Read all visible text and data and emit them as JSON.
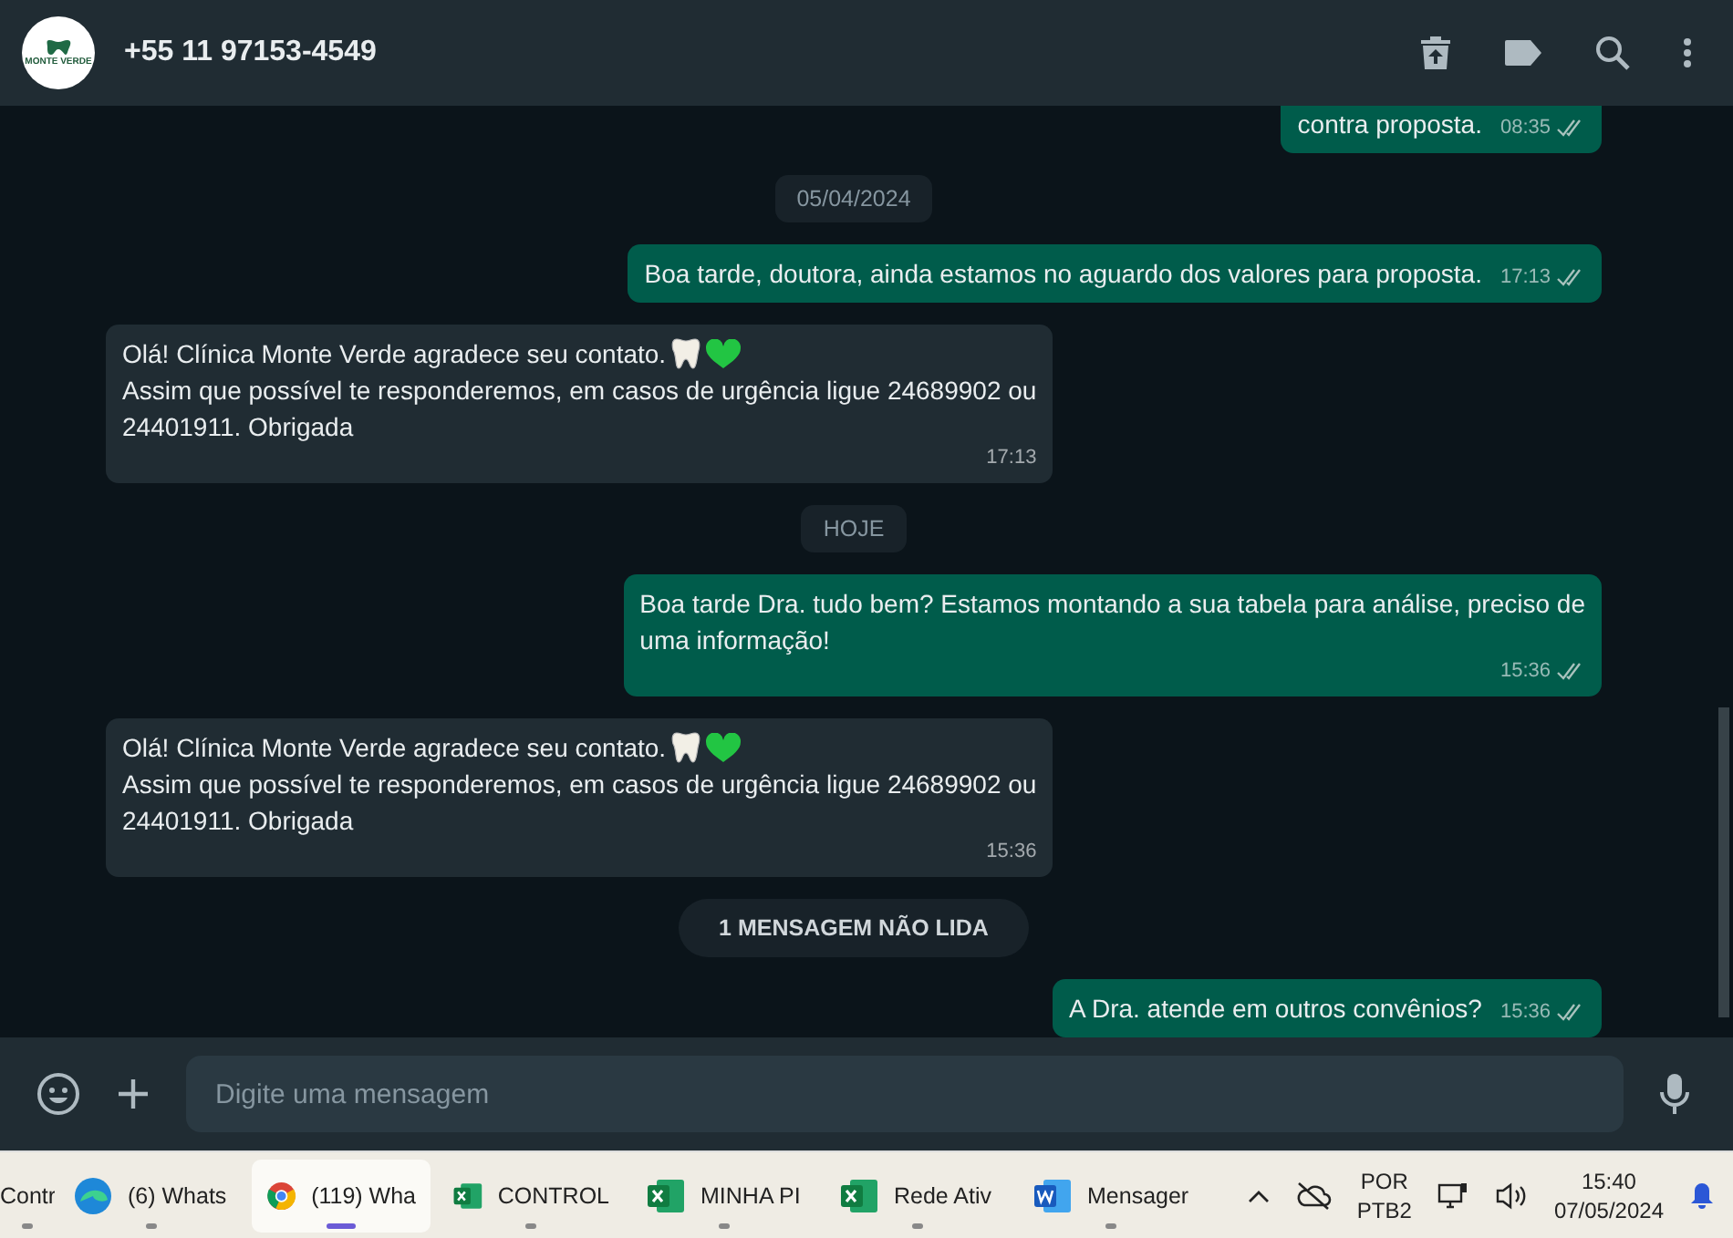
{
  "header": {
    "avatar_text": "MONTE VERDE",
    "contact": "+55 11 97153-4549"
  },
  "messages": [
    {
      "kind": "out",
      "lines": [
        "contra proposta."
      ],
      "time": "08:35",
      "read": true
    },
    {
      "kind": "date",
      "text": "05/04/2024"
    },
    {
      "kind": "out",
      "lines": [
        "Boa tarde, doutora, ainda estamos no aguardo dos valores para proposta."
      ],
      "time": "17:13",
      "read": true
    },
    {
      "kind": "in",
      "lines": [
        "Olá! Clínica Monte Verde agradece seu contato.",
        "Assim que possível te responderemos, em casos de urgência ligue 24689902 ou",
        "24401911. Obrigada"
      ],
      "time": "17:13",
      "emoji": true
    },
    {
      "kind": "date",
      "text": "HOJE"
    },
    {
      "kind": "out",
      "lines": [
        "Boa tarde Dra. tudo bem? Estamos montando a sua tabela para análise, preciso de",
        "uma informação!"
      ],
      "time": "15:36",
      "read": true
    },
    {
      "kind": "in",
      "lines": [
        "Olá! Clínica Monte Verde agradece seu contato.",
        "Assim que possível te responderemos, em casos de urgência ligue 24689902 ou",
        "24401911. Obrigada"
      ],
      "time": "15:36",
      "emoji": true
    },
    {
      "kind": "unread",
      "text": "1 MENSAGEM NÃO LIDA"
    },
    {
      "kind": "out",
      "lines": [
        "A Dra. atende em outros convênios?"
      ],
      "time": "15:36",
      "read": true
    }
  ],
  "composer": {
    "placeholder": "Digite uma mensagem"
  },
  "taskbar": {
    "apps": [
      {
        "kind": "none",
        "label": "Contr",
        "selected": false
      },
      {
        "kind": "edge",
        "label": "(6) Whats",
        "selected": false
      },
      {
        "kind": "chrome",
        "label": "(119) Wha",
        "selected": true
      },
      {
        "kind": "excel",
        "label": "CONTROL",
        "selected": false
      },
      {
        "kind": "excel",
        "label": "MINHA PI",
        "selected": false
      },
      {
        "kind": "excel",
        "label": "Rede Ativ",
        "selected": false
      },
      {
        "kind": "word",
        "label": "Mensager",
        "selected": false
      }
    ],
    "lang": "POR",
    "layout": "PTB2",
    "time": "15:40",
    "date": "07/05/2024"
  }
}
